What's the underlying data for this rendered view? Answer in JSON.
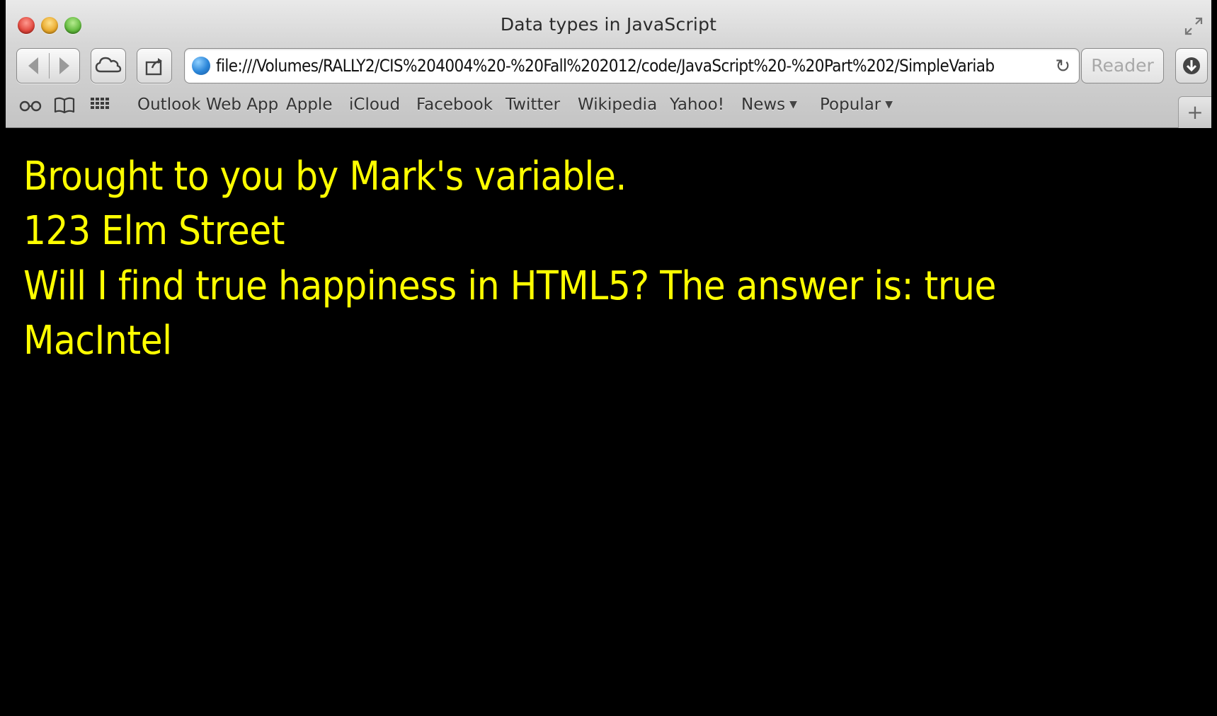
{
  "window": {
    "title": "Data types in JavaScript"
  },
  "toolbar": {
    "url": "file:///Volumes/RALLY2/CIS%204004%20-%20Fall%202012/code/JavaScript%20-%20Part%202/SimpleVariab",
    "reader_label": "Reader"
  },
  "bookmarks": {
    "items": [
      {
        "label": "Outlook Web App"
      },
      {
        "label": "Apple"
      },
      {
        "label": "iCloud"
      },
      {
        "label": "Facebook"
      },
      {
        "label": "Twitter"
      },
      {
        "label": "Wikipedia"
      },
      {
        "label": "Yahoo!"
      },
      {
        "label": "News"
      },
      {
        "label": "Popular"
      }
    ],
    "new_tab": "+"
  },
  "content": {
    "lines": [
      "Brought to you by Mark's variable.",
      "123 Elm Street",
      "Will I find true happiness in HTML5? The answer is: true",
      "MacIntel"
    ],
    "text_color": "#ffff00",
    "background": "#000000"
  }
}
